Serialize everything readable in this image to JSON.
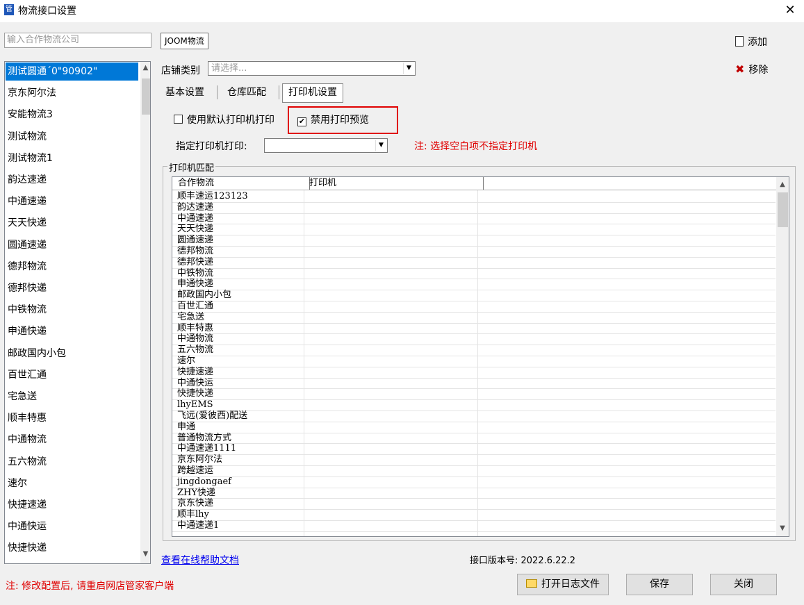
{
  "window": {
    "title": "物流接口设置",
    "close_glyph": "✕"
  },
  "search": {
    "placeholder": "输入合作物流公司"
  },
  "company_list": {
    "selected_index": 0,
    "items": [
      "测试圆通´0\"90902\"",
      "京东阿尔法",
      "安能物流3",
      "测试物流",
      "测试物流1",
      "韵达速递",
      "中通速递",
      "天天快递",
      "圆通速递",
      "德邦物流",
      "德邦快递",
      "中铁物流",
      "申通快递",
      "邮政国内小包",
      "百世汇通",
      "宅急送",
      "顺丰特惠",
      "中通物流",
      "五六物流",
      "速尔",
      "快捷速递",
      "中通快运",
      "快捷快递"
    ]
  },
  "current_company": "JOOM物流",
  "actions": {
    "add_label": "添加",
    "remove_label": "移除"
  },
  "store_type": {
    "label": "店铺类别",
    "placeholder": "请选择..."
  },
  "tabs": [
    {
      "label": "基本设置",
      "active": false
    },
    {
      "label": "仓库匹配",
      "active": false
    },
    {
      "label": "打印机设置",
      "active": true
    }
  ],
  "options": {
    "use_default_printer": {
      "label": "使用默认打印机打印",
      "checked": false
    },
    "disable_preview": {
      "label": "禁用打印预览",
      "checked": true,
      "check_glyph": "✔"
    }
  },
  "specify_printer": {
    "label": "指定打印机打印:",
    "value": "",
    "note": "注: 选择空白项不指定打印机"
  },
  "printer_match": {
    "group_title": "打印机匹配",
    "columns": [
      "合作物流",
      "打印机"
    ],
    "rows": [
      "顺丰速运123123",
      "韵达速递",
      "中通速递",
      "天天快递",
      "圆通速递",
      "德邦物流",
      "德邦快递",
      "中铁物流",
      "申通快递",
      "邮政国内小包",
      "百世汇通",
      "宅急送",
      "顺丰特惠",
      "中通物流",
      "五六物流",
      "速尔",
      "快捷速递",
      "中通快运",
      "快捷快递",
      "lhyEMS",
      "飞远(爱彼西)配送",
      "申通",
      "普通物流方式",
      "中通速递1111",
      "京东阿尔法",
      "跨越速运",
      "jingdongaef",
      "ZHY快递",
      "京东快递",
      "顺丰lhy",
      "中通速递1"
    ]
  },
  "footer": {
    "help_link": "查看在线帮助文档",
    "version_label": "接口版本号: 2022.6.22.2",
    "note": "注: 修改配置后, 请重启网店管家客户端",
    "open_log_label": "打开日志文件",
    "save_label": "保存",
    "close_label": "关闭"
  },
  "colors": {
    "accent": "#0078d7",
    "warning": "#e00000",
    "link": "#0000ee"
  }
}
